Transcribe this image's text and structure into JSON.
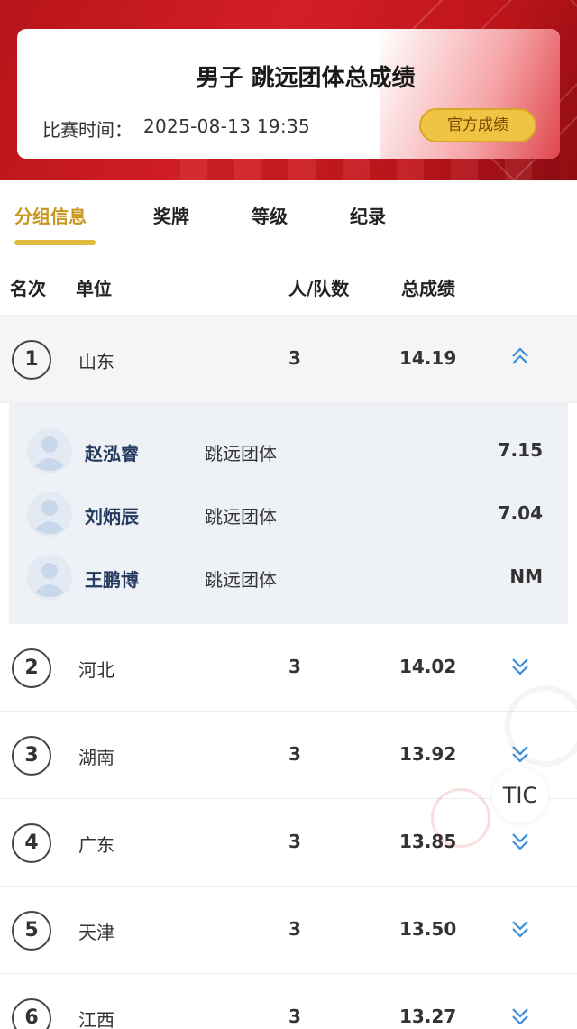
{
  "header": {
    "title": "男子 跳远团体总成绩",
    "time_label": "比赛时间：",
    "time_value": "2025-08-13  19:35",
    "official_button": "官方成绩"
  },
  "tabs": [
    {
      "label": "分组信息",
      "active": true
    },
    {
      "label": "奖牌",
      "active": false
    },
    {
      "label": "等级",
      "active": false
    },
    {
      "label": "纪录",
      "active": false
    }
  ],
  "table": {
    "headers": {
      "rank": "名次",
      "unit": "单位",
      "count": "人/队数",
      "total": "总成绩"
    },
    "rows": [
      {
        "rank": "1",
        "unit": "山东",
        "count": "3",
        "total": "14.19",
        "expanded": true
      },
      {
        "rank": "2",
        "unit": "河北",
        "count": "3",
        "total": "14.02",
        "expanded": false
      },
      {
        "rank": "3",
        "unit": "湖南",
        "count": "3",
        "total": "13.92",
        "expanded": false
      },
      {
        "rank": "4",
        "unit": "广东",
        "count": "3",
        "total": "13.85",
        "expanded": false
      },
      {
        "rank": "5",
        "unit": "天津",
        "count": "3",
        "total": "13.50",
        "expanded": false
      },
      {
        "rank": "6",
        "unit": "江西",
        "count": "3",
        "total": "13.27",
        "expanded": false
      }
    ],
    "members": [
      {
        "name": "赵泓睿",
        "event": "跳远团体",
        "score": "7.15"
      },
      {
        "name": "刘炳辰",
        "event": "跳远团体",
        "score": "7.04"
      },
      {
        "name": "王鹏博",
        "event": "跳远团体",
        "score": "NM"
      }
    ]
  },
  "floating": {
    "label": "TIC"
  },
  "colors": {
    "brand_red": "#d31f25",
    "gold": "#e2b83d",
    "chevron_blue": "#3a8fd8"
  },
  "icons": {
    "expand": "chevron-double-down-icon",
    "collapse": "chevron-double-up-icon",
    "avatar": "user-avatar-icon"
  }
}
